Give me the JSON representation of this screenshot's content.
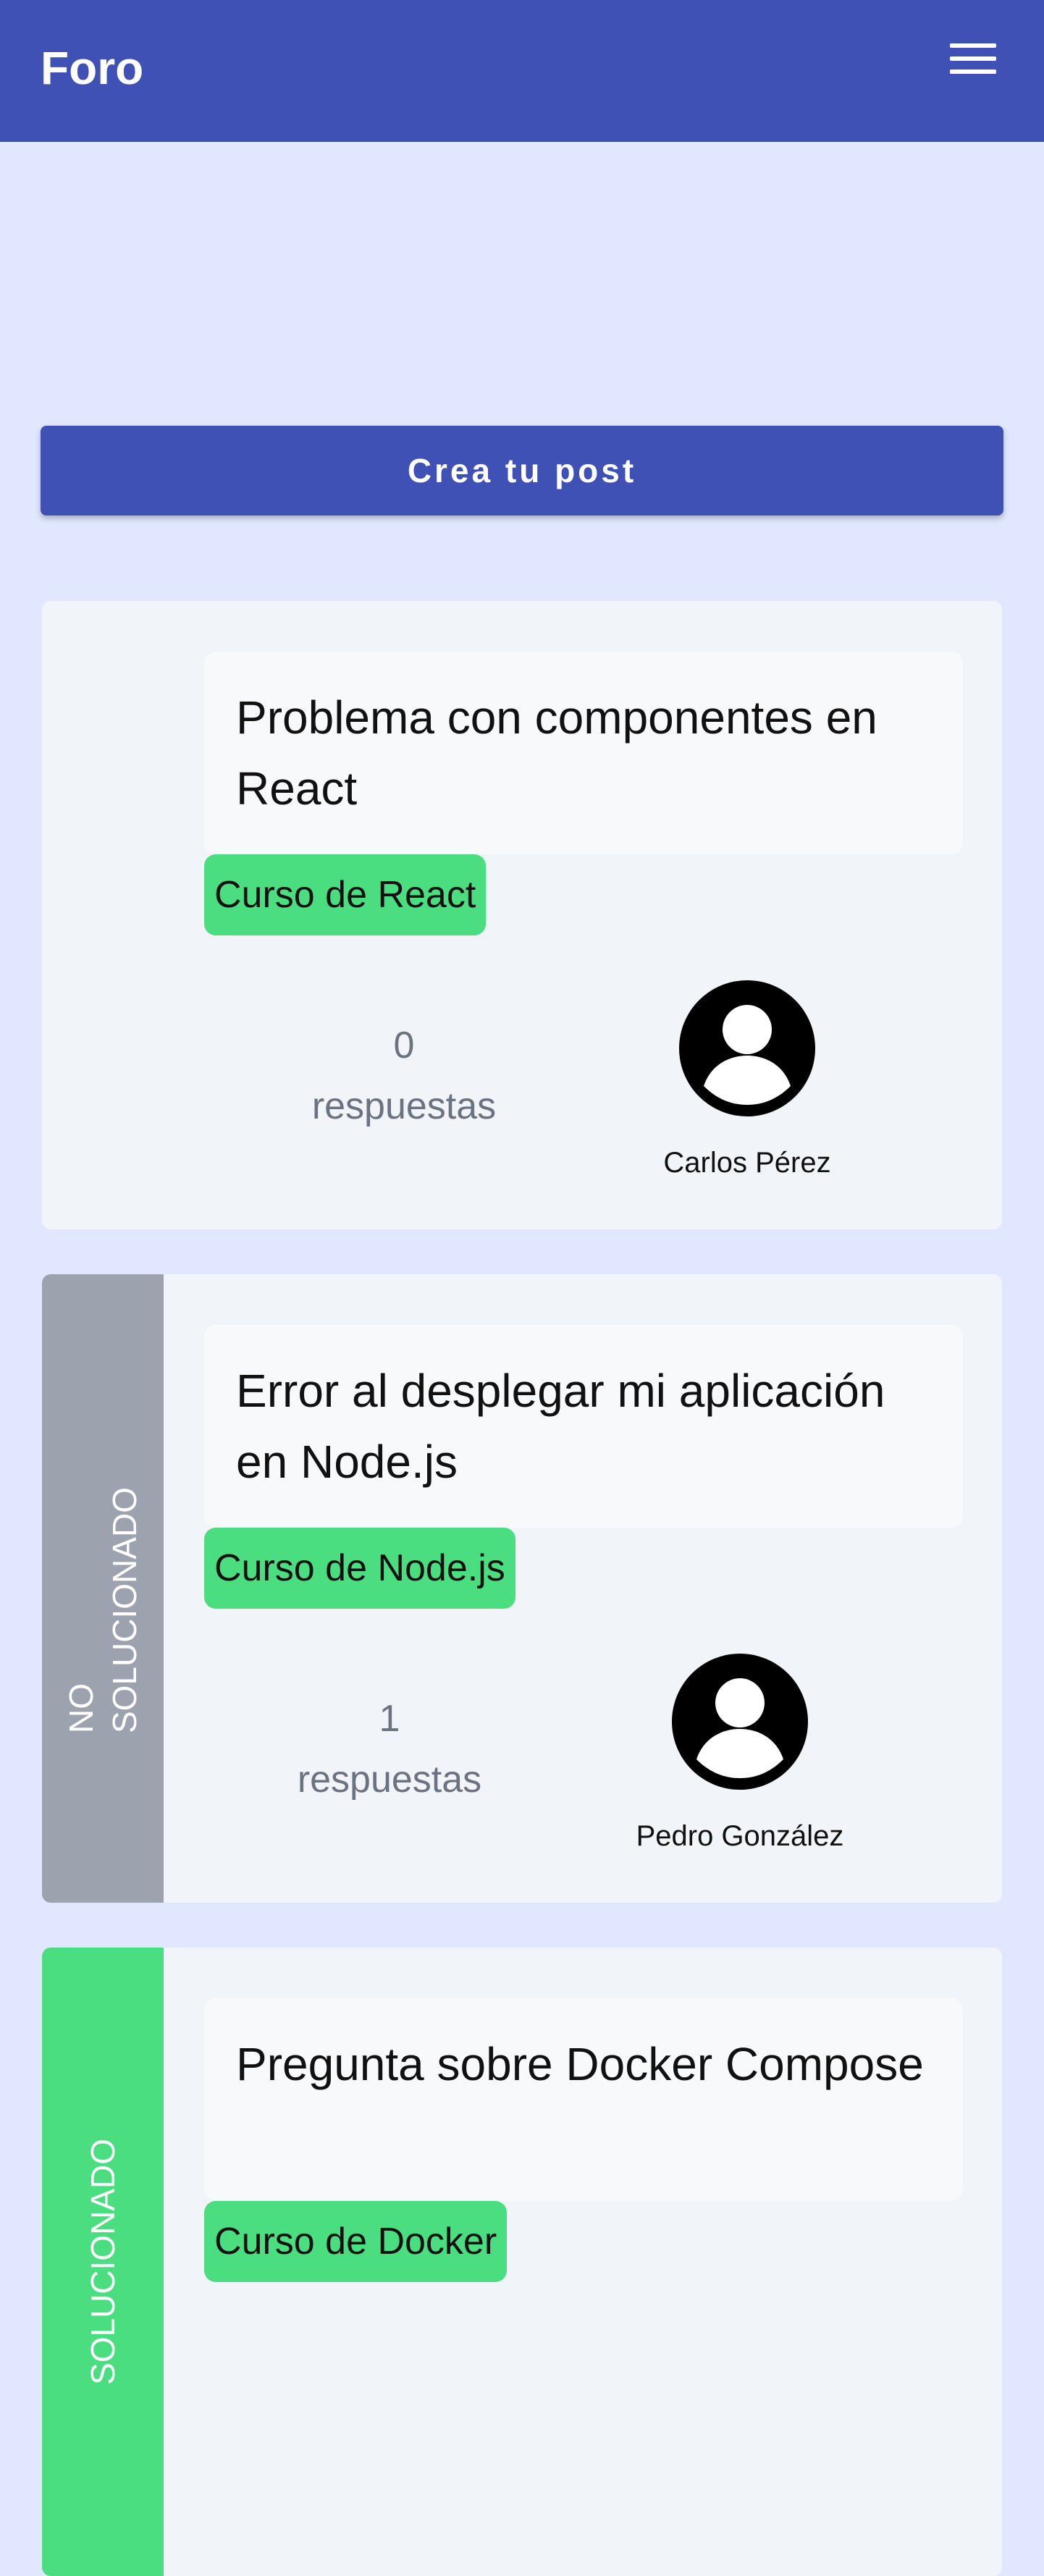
{
  "header": {
    "brand": "Foro",
    "menu_icon": "menu-icon"
  },
  "actions": {
    "create_post": "Crea tu post"
  },
  "colors": {
    "header": "#3f51b5",
    "background": "#e0e7ff",
    "card": "#f1f4f9",
    "tag": "#4ade80",
    "status_unsolved": "#9ca3af",
    "status_solved": "#4ade80"
  },
  "posts": [
    {
      "status": "",
      "title": "Problema con componentes en React",
      "tag": "Curso de React",
      "answers_count": "0",
      "answers_label": "respuestas",
      "author": "Carlos Pérez",
      "avatar_icon": "user-avatar-icon"
    },
    {
      "status": "NO SOLUCIONADO",
      "title": "Error al desplegar mi aplicación en Node.js",
      "tag": "Curso de Node.js",
      "answers_count": "1",
      "answers_label": "respuestas",
      "author": "Pedro González",
      "avatar_icon": "user-avatar-icon"
    },
    {
      "status": "SOLUCIONADO",
      "title": "Pregunta sobre Docker Compose",
      "tag": "Curso de Docker",
      "answers_count": "",
      "answers_label": "",
      "author": "",
      "avatar_icon": "user-avatar-icon"
    }
  ]
}
